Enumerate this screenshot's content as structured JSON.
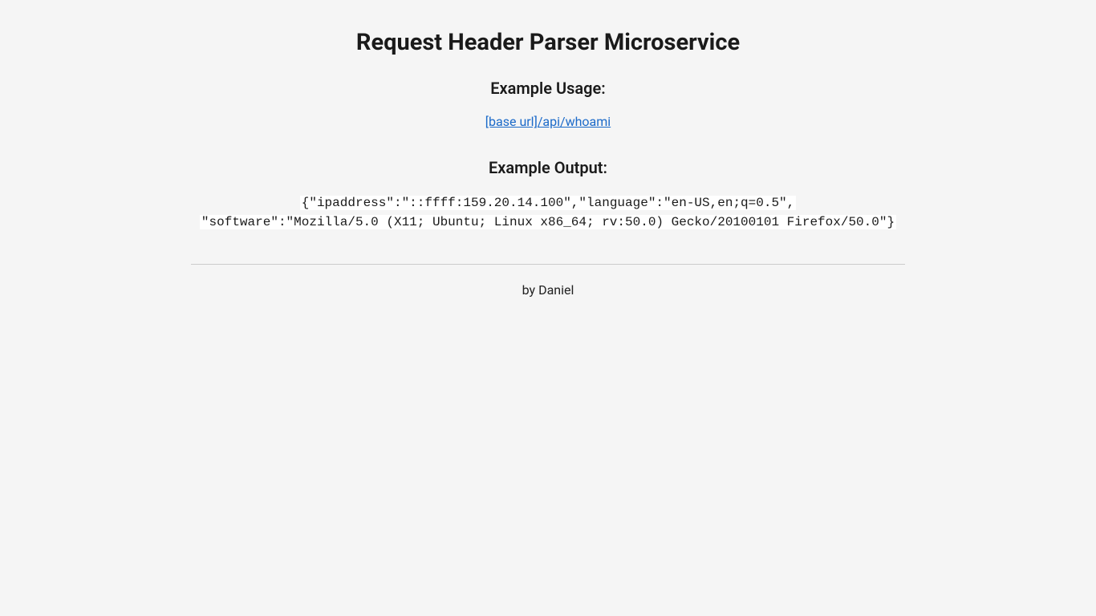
{
  "title": "Request Header Parser Microservice",
  "usage": {
    "heading": "Example Usage:",
    "link_text": "[base url]/api/whoami"
  },
  "output": {
    "heading": "Example Output:",
    "line1": "{\"ipaddress\":\"::ffff:159.20.14.100\",\"language\":\"en-US,en;q=0.5\",",
    "line2": "\"software\":\"Mozilla/5.0 (X11; Ubuntu; Linux x86_64; rv:50.0) Gecko/20100101 Firefox/50.0\"}"
  },
  "footer": {
    "byline": "by Daniel"
  }
}
